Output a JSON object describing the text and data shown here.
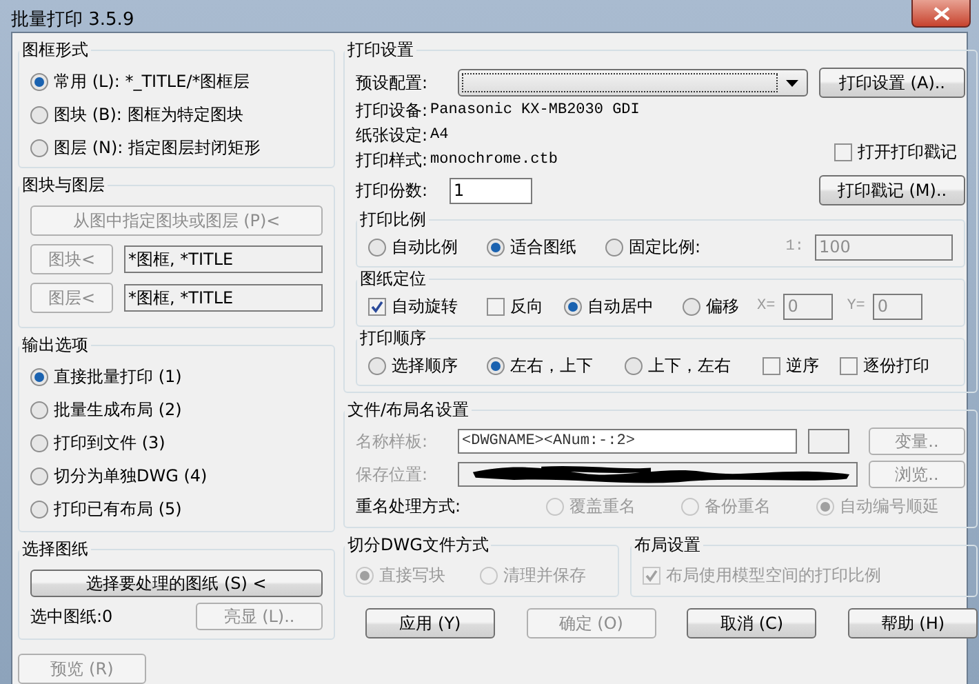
{
  "window": {
    "title": "批量打印 3.5.9"
  },
  "frame_style": {
    "title": "图框形式",
    "options": [
      {
        "label": "常用 (L): *_TITLE/*图框层",
        "selected": true
      },
      {
        "label": "图块 (B): 图框为特定图块",
        "selected": false
      },
      {
        "label": "图层 (N): 指定图层封闭矩形",
        "selected": false
      }
    ]
  },
  "block_layer": {
    "title": "图块与图层",
    "pick_button": {
      "label": "从图中指定图块或图层 (P)<",
      "disabled": true
    },
    "rows": [
      {
        "button": {
          "label": "图块<",
          "disabled": true
        },
        "value": "*图框, *TITLE"
      },
      {
        "button": {
          "label": "图层<",
          "disabled": true
        },
        "value": "*图框, *TITLE"
      }
    ]
  },
  "output": {
    "title": "输出选项",
    "options": [
      {
        "label": "直接批量打印 (1)",
        "selected": true
      },
      {
        "label": "批量生成布局 (2)",
        "selected": false
      },
      {
        "label": "打印到文件 (3)",
        "selected": false
      },
      {
        "label": "切分为单独DWG (4)",
        "selected": false
      },
      {
        "label": "打印已有布局 (5)",
        "selected": false
      }
    ]
  },
  "select_sheets": {
    "title": "选择图纸",
    "select_button": {
      "label": "选择要处理的图纸 (S) <",
      "disabled": false
    },
    "count": "选中图纸:0",
    "highlight_button": {
      "label": "亮显 (L)..",
      "disabled": true
    }
  },
  "preview_button": {
    "label": "预览 (R)",
    "disabled": true
  },
  "print_settings": {
    "title": "打印设置",
    "preset_label": "预设配置:",
    "setup_button": {
      "label": "打印设置 (A)..",
      "disabled": false
    },
    "info": [
      {
        "label": "打印设备:",
        "value": "Panasonic KX-MB2030 GDI"
      },
      {
        "label": "纸张设定:",
        "value": "A4"
      },
      {
        "label": "打印样式:",
        "value": "monochrome.ctb"
      }
    ],
    "copies": {
      "label": "打印份数:",
      "value": "1"
    },
    "stamp_checkbox": {
      "label": "打开打印戳记",
      "checked": false,
      "disabled": false
    },
    "stamp_button": {
      "label": "打印戳记 (M)..",
      "disabled": false
    },
    "scale": {
      "title": "打印比例",
      "options": [
        {
          "label": "自动比例",
          "selected": false
        },
        {
          "label": "适合图纸",
          "selected": true
        },
        {
          "label": "固定比例:",
          "selected": false
        }
      ],
      "ratio": {
        "label": "1:",
        "value": "100",
        "disabled": true
      }
    },
    "position": {
      "title": "图纸定位",
      "items": [
        {
          "kind": "checkbox",
          "label": "自动旋转",
          "checked": true
        },
        {
          "kind": "checkbox",
          "label": "反向",
          "checked": false
        },
        {
          "kind": "radio",
          "label": "自动居中",
          "selected": true
        },
        {
          "kind": "radio",
          "label": "偏移",
          "selected": false
        }
      ],
      "offsets": [
        {
          "label": "X=",
          "value": "0",
          "disabled": true
        },
        {
          "label": "Y=",
          "value": "0",
          "disabled": true
        }
      ]
    },
    "order": {
      "title": "打印顺序",
      "items": [
        {
          "kind": "radio",
          "label": "选择顺序",
          "selected": false
        },
        {
          "kind": "radio",
          "label": "左右，上下",
          "selected": true
        },
        {
          "kind": "radio",
          "label": "上下，左右",
          "selected": false
        },
        {
          "kind": "checkbox",
          "label": "逆序",
          "checked": false
        },
        {
          "kind": "checkbox",
          "label": "逐份打印",
          "checked": false
        }
      ]
    }
  },
  "file_naming": {
    "title": "文件/布局名设置",
    "template": {
      "label": "名称样板:",
      "value": "<DWGNAME><ANum:-:2>",
      "disabled": true
    },
    "variable_button": {
      "label": "变量..",
      "disabled": true
    },
    "save_location": {
      "label": "保存位置:",
      "disabled": true
    },
    "browse_button": {
      "label": "浏览..",
      "disabled": true
    },
    "rename_label": "重名处理方式:",
    "rename_options": [
      {
        "label": "覆盖重名",
        "selected": false,
        "disabled": true
      },
      {
        "label": "备份重名",
        "selected": false,
        "disabled": true
      },
      {
        "label": "自动编号顺延",
        "selected": true,
        "disabled": true
      }
    ]
  },
  "split_dwg": {
    "title": "切分DWG文件方式",
    "options": [
      {
        "label": "直接写块",
        "selected": true,
        "disabled": true
      },
      {
        "label": "清理并保存",
        "selected": false,
        "disabled": true
      }
    ]
  },
  "layout_settings": {
    "title": "布局设置",
    "checkbox": {
      "label": "布局使用模型空间的打印比例",
      "checked": true,
      "disabled": true
    }
  },
  "buttons": [
    {
      "label": "应用 (Y)",
      "disabled": false
    },
    {
      "label": "确定 (O)",
      "disabled": true
    },
    {
      "label": "取消 (C)",
      "disabled": false
    },
    {
      "label": "帮助 (H)",
      "disabled": false
    }
  ]
}
